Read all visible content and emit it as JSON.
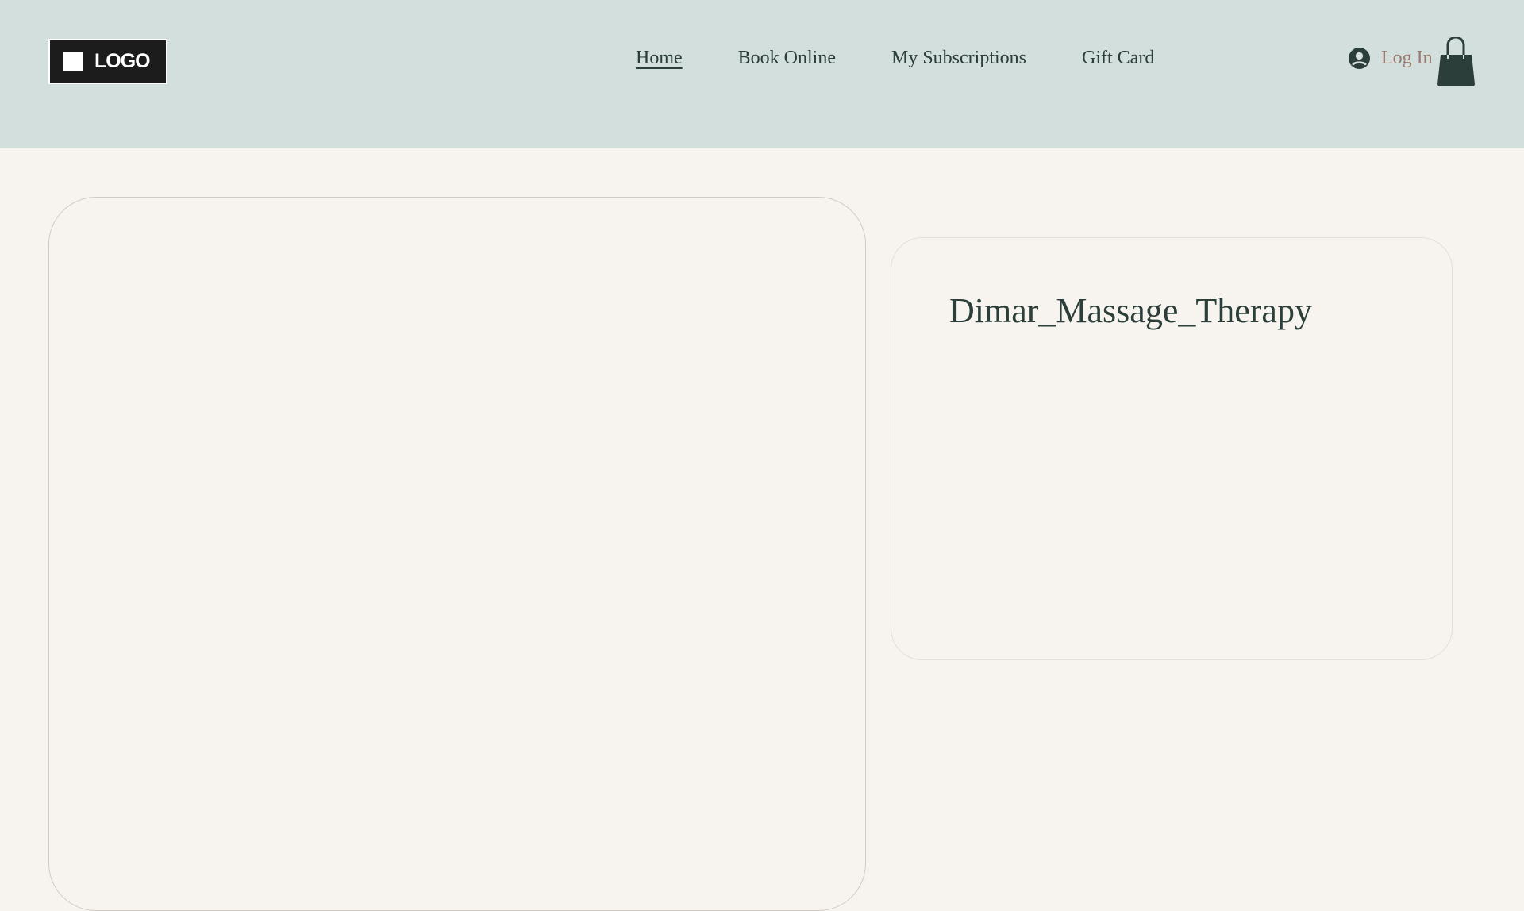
{
  "header": {
    "logo_text": "LOGO",
    "nav": [
      {
        "label": "Home",
        "active": true
      },
      {
        "label": "Book Online"
      },
      {
        "label": "My Subscriptions"
      },
      {
        "label": "Gift Card"
      }
    ],
    "login_label": "Log In"
  },
  "main": {
    "business_name": "Dimar_Massage_Therapy"
  },
  "colors": {
    "header_bg": "#d3dfdc",
    "page_bg": "#f7f4ef",
    "text": "#2c3e3a",
    "login": "#9a7a6e"
  }
}
